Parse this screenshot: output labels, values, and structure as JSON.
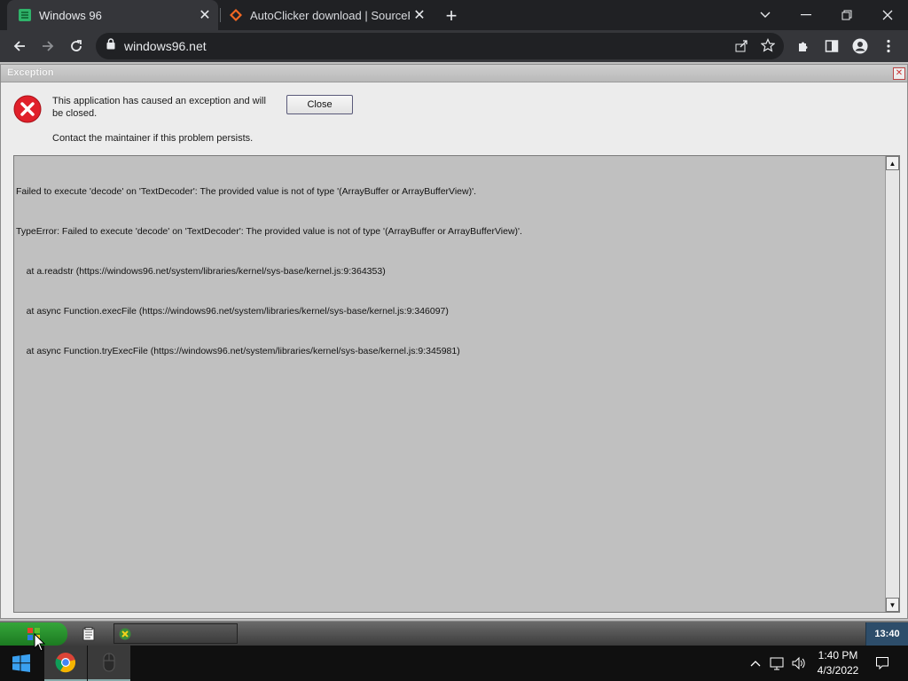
{
  "browser": {
    "tabs": [
      {
        "title": "Windows 96",
        "active": true,
        "icon": "windows96-favicon"
      },
      {
        "title": "AutoClicker download | SourceFo",
        "active": false,
        "icon": "sourceforge-favicon"
      }
    ],
    "url": "windows96.net"
  },
  "dialog": {
    "title": "Exception",
    "message": "This application has caused an exception and will be closed.",
    "hint": "Contact the maintainer if this problem persists.",
    "close_label": "Close",
    "log_lines": [
      "Failed to execute 'decode' on 'TextDecoder': The provided value is not of type '(ArrayBuffer or ArrayBufferView)'.",
      "TypeError: Failed to execute 'decode' on 'TextDecoder': The provided value is not of type '(ArrayBuffer or ArrayBufferView)'.",
      "    at a.readstr (https://windows96.net/system/libraries/kernel/sys-base/kernel.js:9:364353)",
      "    at async Function.execFile (https://windows96.net/system/libraries/kernel/sys-base/kernel.js:9:346097)",
      "    at async Function.tryExecFile (https://windows96.net/system/libraries/kernel/sys-base/kernel.js:9:345981)"
    ]
  },
  "w96_taskbar": {
    "clock": "13:40"
  },
  "os_taskbar": {
    "time": "1:40 PM",
    "date": "4/3/2022"
  }
}
